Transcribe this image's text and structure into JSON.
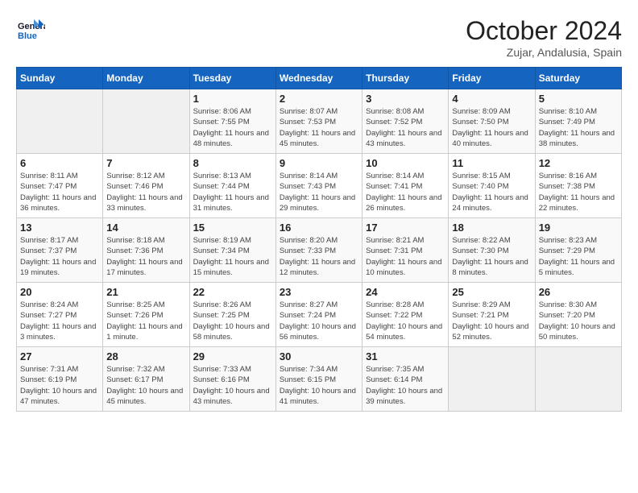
{
  "header": {
    "logo": {
      "line1": "General",
      "line2": "Blue"
    },
    "title": "October 2024",
    "subtitle": "Zujar, Andalusia, Spain"
  },
  "days_of_week": [
    "Sunday",
    "Monday",
    "Tuesday",
    "Wednesday",
    "Thursday",
    "Friday",
    "Saturday"
  ],
  "weeks": [
    [
      {
        "day": null
      },
      {
        "day": null
      },
      {
        "day": "1",
        "info": "Sunrise: 8:06 AM\nSunset: 7:55 PM\nDaylight: 11 hours and 48 minutes."
      },
      {
        "day": "2",
        "info": "Sunrise: 8:07 AM\nSunset: 7:53 PM\nDaylight: 11 hours and 45 minutes."
      },
      {
        "day": "3",
        "info": "Sunrise: 8:08 AM\nSunset: 7:52 PM\nDaylight: 11 hours and 43 minutes."
      },
      {
        "day": "4",
        "info": "Sunrise: 8:09 AM\nSunset: 7:50 PM\nDaylight: 11 hours and 40 minutes."
      },
      {
        "day": "5",
        "info": "Sunrise: 8:10 AM\nSunset: 7:49 PM\nDaylight: 11 hours and 38 minutes."
      }
    ],
    [
      {
        "day": "6",
        "info": "Sunrise: 8:11 AM\nSunset: 7:47 PM\nDaylight: 11 hours and 36 minutes."
      },
      {
        "day": "7",
        "info": "Sunrise: 8:12 AM\nSunset: 7:46 PM\nDaylight: 11 hours and 33 minutes."
      },
      {
        "day": "8",
        "info": "Sunrise: 8:13 AM\nSunset: 7:44 PM\nDaylight: 11 hours and 31 minutes."
      },
      {
        "day": "9",
        "info": "Sunrise: 8:14 AM\nSunset: 7:43 PM\nDaylight: 11 hours and 29 minutes."
      },
      {
        "day": "10",
        "info": "Sunrise: 8:14 AM\nSunset: 7:41 PM\nDaylight: 11 hours and 26 minutes."
      },
      {
        "day": "11",
        "info": "Sunrise: 8:15 AM\nSunset: 7:40 PM\nDaylight: 11 hours and 24 minutes."
      },
      {
        "day": "12",
        "info": "Sunrise: 8:16 AM\nSunset: 7:38 PM\nDaylight: 11 hours and 22 minutes."
      }
    ],
    [
      {
        "day": "13",
        "info": "Sunrise: 8:17 AM\nSunset: 7:37 PM\nDaylight: 11 hours and 19 minutes."
      },
      {
        "day": "14",
        "info": "Sunrise: 8:18 AM\nSunset: 7:36 PM\nDaylight: 11 hours and 17 minutes."
      },
      {
        "day": "15",
        "info": "Sunrise: 8:19 AM\nSunset: 7:34 PM\nDaylight: 11 hours and 15 minutes."
      },
      {
        "day": "16",
        "info": "Sunrise: 8:20 AM\nSunset: 7:33 PM\nDaylight: 11 hours and 12 minutes."
      },
      {
        "day": "17",
        "info": "Sunrise: 8:21 AM\nSunset: 7:31 PM\nDaylight: 11 hours and 10 minutes."
      },
      {
        "day": "18",
        "info": "Sunrise: 8:22 AM\nSunset: 7:30 PM\nDaylight: 11 hours and 8 minutes."
      },
      {
        "day": "19",
        "info": "Sunrise: 8:23 AM\nSunset: 7:29 PM\nDaylight: 11 hours and 5 minutes."
      }
    ],
    [
      {
        "day": "20",
        "info": "Sunrise: 8:24 AM\nSunset: 7:27 PM\nDaylight: 11 hours and 3 minutes."
      },
      {
        "day": "21",
        "info": "Sunrise: 8:25 AM\nSunset: 7:26 PM\nDaylight: 11 hours and 1 minute."
      },
      {
        "day": "22",
        "info": "Sunrise: 8:26 AM\nSunset: 7:25 PM\nDaylight: 10 hours and 58 minutes."
      },
      {
        "day": "23",
        "info": "Sunrise: 8:27 AM\nSunset: 7:24 PM\nDaylight: 10 hours and 56 minutes."
      },
      {
        "day": "24",
        "info": "Sunrise: 8:28 AM\nSunset: 7:22 PM\nDaylight: 10 hours and 54 minutes."
      },
      {
        "day": "25",
        "info": "Sunrise: 8:29 AM\nSunset: 7:21 PM\nDaylight: 10 hours and 52 minutes."
      },
      {
        "day": "26",
        "info": "Sunrise: 8:30 AM\nSunset: 7:20 PM\nDaylight: 10 hours and 50 minutes."
      }
    ],
    [
      {
        "day": "27",
        "info": "Sunrise: 7:31 AM\nSunset: 6:19 PM\nDaylight: 10 hours and 47 minutes."
      },
      {
        "day": "28",
        "info": "Sunrise: 7:32 AM\nSunset: 6:17 PM\nDaylight: 10 hours and 45 minutes."
      },
      {
        "day": "29",
        "info": "Sunrise: 7:33 AM\nSunset: 6:16 PM\nDaylight: 10 hours and 43 minutes."
      },
      {
        "day": "30",
        "info": "Sunrise: 7:34 AM\nSunset: 6:15 PM\nDaylight: 10 hours and 41 minutes."
      },
      {
        "day": "31",
        "info": "Sunrise: 7:35 AM\nSunset: 6:14 PM\nDaylight: 10 hours and 39 minutes."
      },
      {
        "day": null
      },
      {
        "day": null
      }
    ]
  ]
}
